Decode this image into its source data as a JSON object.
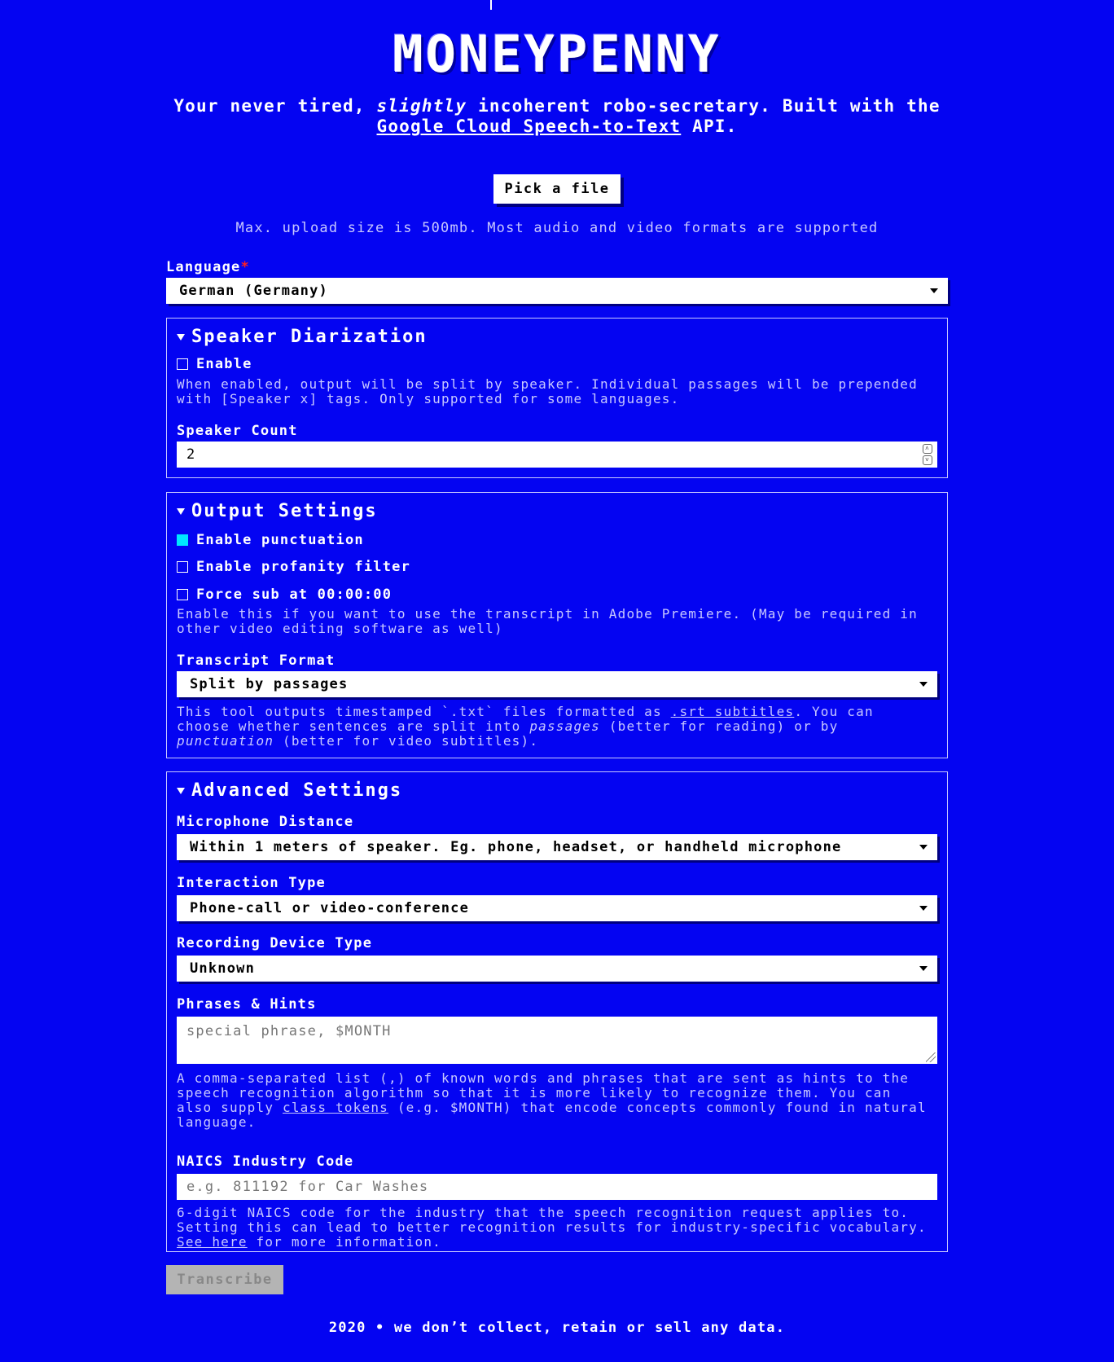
{
  "logo": {
    "text": "MONEYPENNY"
  },
  "tagline": {
    "part1": "Your never tired, ",
    "em": "slightly",
    "part2": " incoherent robo-secretary. Built with the ",
    "link": "Google Cloud Speech-to-Text",
    "part3": " API."
  },
  "upload": {
    "button_label": "Pick a file",
    "note": "Max. upload size is 500mb. Most audio and video formats are supported"
  },
  "language": {
    "label": "Language",
    "required_mark": "*",
    "value": "German (Germany)"
  },
  "diarization": {
    "title": "Speaker Diarization",
    "enable_label": "Enable",
    "enable_checked": false,
    "help": "When enabled, output will be split by speaker. Individual passages will be prepended with [Speaker x] tags. Only supported for some languages.",
    "count_label": "Speaker Count",
    "count_value": "2"
  },
  "output": {
    "title": "Output Settings",
    "punctuation_label": "Enable punctuation",
    "punctuation_checked": true,
    "profanity_label": "Enable profanity filter",
    "profanity_checked": false,
    "forcesub_label": "Force sub at 00:00:00",
    "forcesub_checked": false,
    "forcesub_help": "Enable this if you want to use the transcript in Adobe Premiere. (May be required in other video editing software as well)",
    "format_label": "Transcript Format",
    "format_value": "Split by passages",
    "format_help_1": "This tool outputs timestamped `.txt` files formatted as ",
    "format_help_link": ".srt subtitles",
    "format_help_2": ". You can choose whether sentences are split into ",
    "format_help_em1": "passages",
    "format_help_3": " (better for reading) or by ",
    "format_help_em2": "punctuation",
    "format_help_4": " (better for video subtitles)."
  },
  "advanced": {
    "title": "Advanced Settings",
    "mic_label": "Microphone Distance",
    "mic_value": "Within 1 meters of speaker. Eg. phone, headset, or handheld microphone",
    "interaction_label": "Interaction Type",
    "interaction_value": "Phone-call or video-conference",
    "device_label": "Recording Device Type",
    "device_value": "Unknown",
    "phrases_label": "Phrases & Hints",
    "phrases_placeholder": "special phrase, $MONTH",
    "phrases_help_1": "A comma-separated list (,) of known words and phrases that are sent as hints to the speech recognition algorithm so that it is more likely to recognize them. You can also supply ",
    "phrases_help_link": "class tokens",
    "phrases_help_2": " (e.g. $MONTH) that encode concepts commonly found in natural language.",
    "naics_label": "NAICS Industry Code",
    "naics_placeholder": "e.g. 811192 for Car Washes",
    "naics_help_1": "6-digit NAICS code for the industry that the speech recognition request applies to. Setting this can lead to better recognition results for industry-specific vocabulary. ",
    "naics_help_link": "See here",
    "naics_help_2": " for more information."
  },
  "transcribe": {
    "label": "Transcribe"
  },
  "footer": {
    "text": "2020 • we don’t collect, retain or sell any data."
  },
  "colors": {
    "background": "#0404f2",
    "accent": "#00e5ff",
    "muted": "#c8c8ff",
    "required": "#ff2020"
  }
}
